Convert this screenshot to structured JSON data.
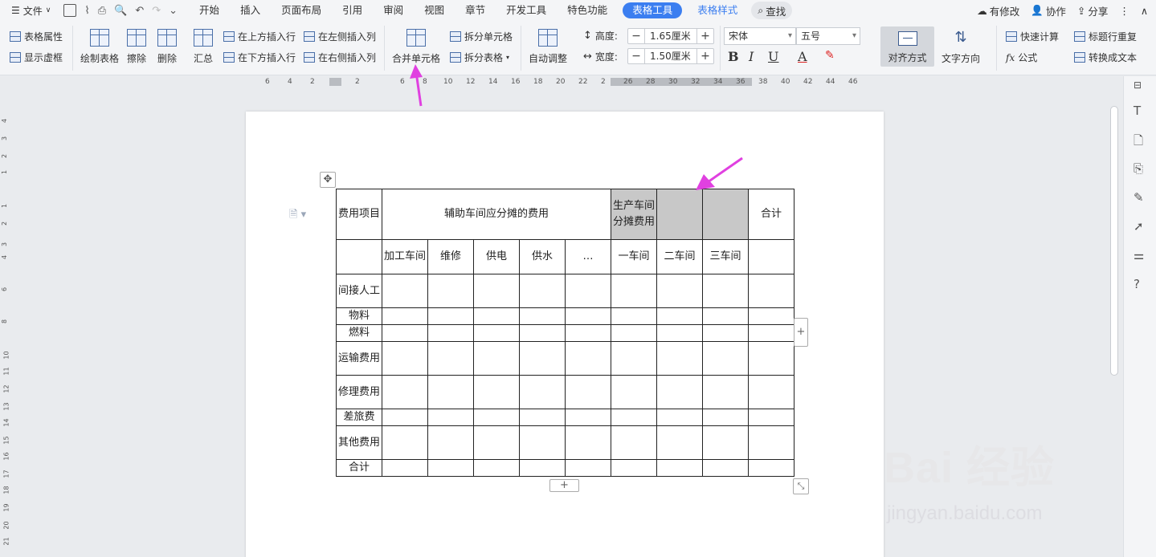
{
  "menu": {
    "file_label": "文件",
    "tabs": [
      "开始",
      "插入",
      "页面布局",
      "引用",
      "审阅",
      "视图",
      "章节",
      "开发工具",
      "特色功能",
      "表格工具",
      "表格样式"
    ],
    "active_tab": "表格工具",
    "search_label": "查找",
    "right": {
      "modified": "有修改",
      "collab": "协作",
      "share": "分享"
    }
  },
  "ribbon": {
    "table_props": "表格属性",
    "show_grid": "显示虚框",
    "draw_table": "绘制表格",
    "erase": "擦除",
    "delete": "删除",
    "summary": "汇总",
    "insert_above": "在上方插入行",
    "insert_below": "在下方插入行",
    "insert_left": "在左侧插入列",
    "insert_right": "在右侧插入列",
    "merge_cells": "合并单元格",
    "split_cells": "拆分单元格",
    "split_table": "拆分表格",
    "auto_adjust": "自动调整",
    "height_label": "高度:",
    "height_value": "1.65厘米",
    "width_label": "宽度:",
    "width_value": "1.50厘米",
    "font_name": "宋体",
    "font_size": "五号",
    "bold": "B",
    "italic": "I",
    "underline": "U",
    "font_color": "A",
    "align": "对齐方式",
    "text_direction": "文字方向",
    "quick_calc": "快速计算",
    "formula": "公式",
    "repeat_header": "标题行重复",
    "convert_text": "转换成文本"
  },
  "ruler": {
    "h_ticks": [
      "6",
      "4",
      "2",
      "2",
      "6",
      "8",
      "10",
      "12",
      "14",
      "16",
      "18",
      "20",
      "22",
      "2",
      "26",
      "28",
      "30",
      "32",
      "34",
      "36",
      "38",
      "40",
      "42",
      "44",
      "46"
    ],
    "v_ticks": [
      "4",
      "3",
      "2",
      "1",
      "1",
      "2",
      "3",
      "4",
      "6",
      "8",
      "10",
      "11",
      "12",
      "13",
      "14",
      "15",
      "16",
      "17",
      "18",
      "19",
      "20",
      "21"
    ]
  },
  "table": {
    "row1": {
      "c1": "费用项目",
      "c2": "辅助车间应分摊的费用",
      "c3": "生产车间分摊费用",
      "c4": "",
      "c5": "",
      "c6": "合计"
    },
    "row2": [
      "",
      "加工车间",
      "维修",
      "供电",
      "供水",
      "…",
      "一车间",
      "二车间",
      "三车间",
      ""
    ],
    "body_rows": [
      "间接人工",
      "物料",
      "燃料",
      "运输费用",
      "修理费用",
      "差旅费",
      "其他费用",
      "合计"
    ]
  },
  "watermark": {
    "brand": "Bai 经验",
    "url": "jingyan.baidu.com"
  },
  "colors": {
    "accent": "#3b7ef0",
    "arrow": "#e040e0",
    "selected_cell": "#c8c8c8"
  }
}
